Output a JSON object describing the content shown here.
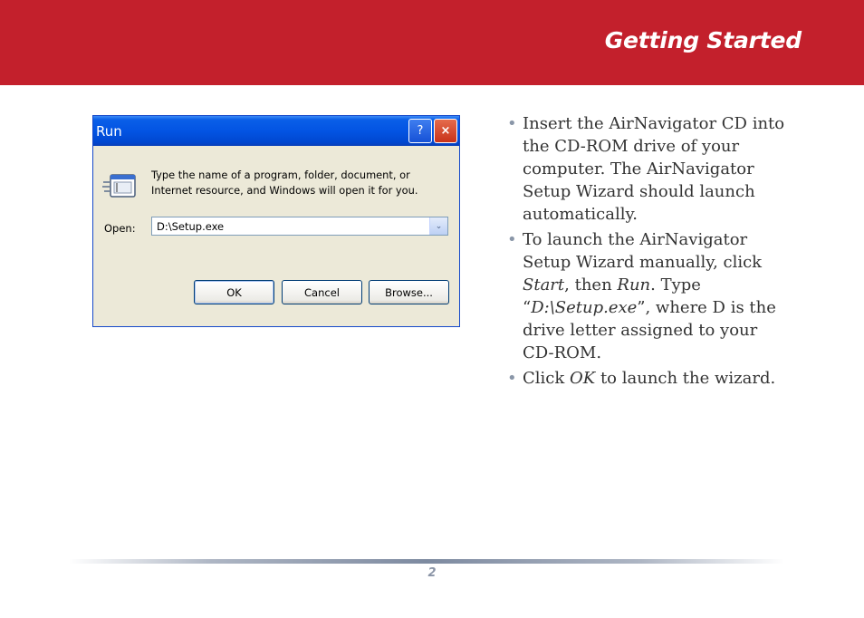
{
  "header": {
    "title": "Getting Started",
    "color": "#c3202c"
  },
  "run_dialog": {
    "title": "Run",
    "help_label": "?",
    "close_label": "×",
    "icon": "run-program-icon",
    "description": "Type the name of a program, folder, document, or Internet resource, and Windows will open it for you.",
    "open_label": "Open:",
    "open_value": "D:\\Setup.exe",
    "dropdown_glyph": "⌄",
    "buttons": {
      "ok": "OK",
      "cancel": "Cancel",
      "browse": "Browse..."
    }
  },
  "instructions": {
    "bullet_glyph": "•",
    "items": [
      {
        "text": "Insert the AirNavigator CD into the CD-ROM drive of your computer. The AirNavigator Setup Wizard should launch automatically."
      },
      {
        "p1": "To launch the AirNavigator Setup Wizard manually, click ",
        "start": "Start",
        "p2": ", then ",
        "run": "Run",
        "p3": ". Type “",
        "path": "D:\\Setup.exe",
        "p4": "”, where D is the drive letter assigned to your CD-ROM."
      },
      {
        "p1": "Click ",
        "ok": "OK",
        "p2": " to launch the wizard."
      }
    ]
  },
  "footer": {
    "page_number": "2"
  }
}
